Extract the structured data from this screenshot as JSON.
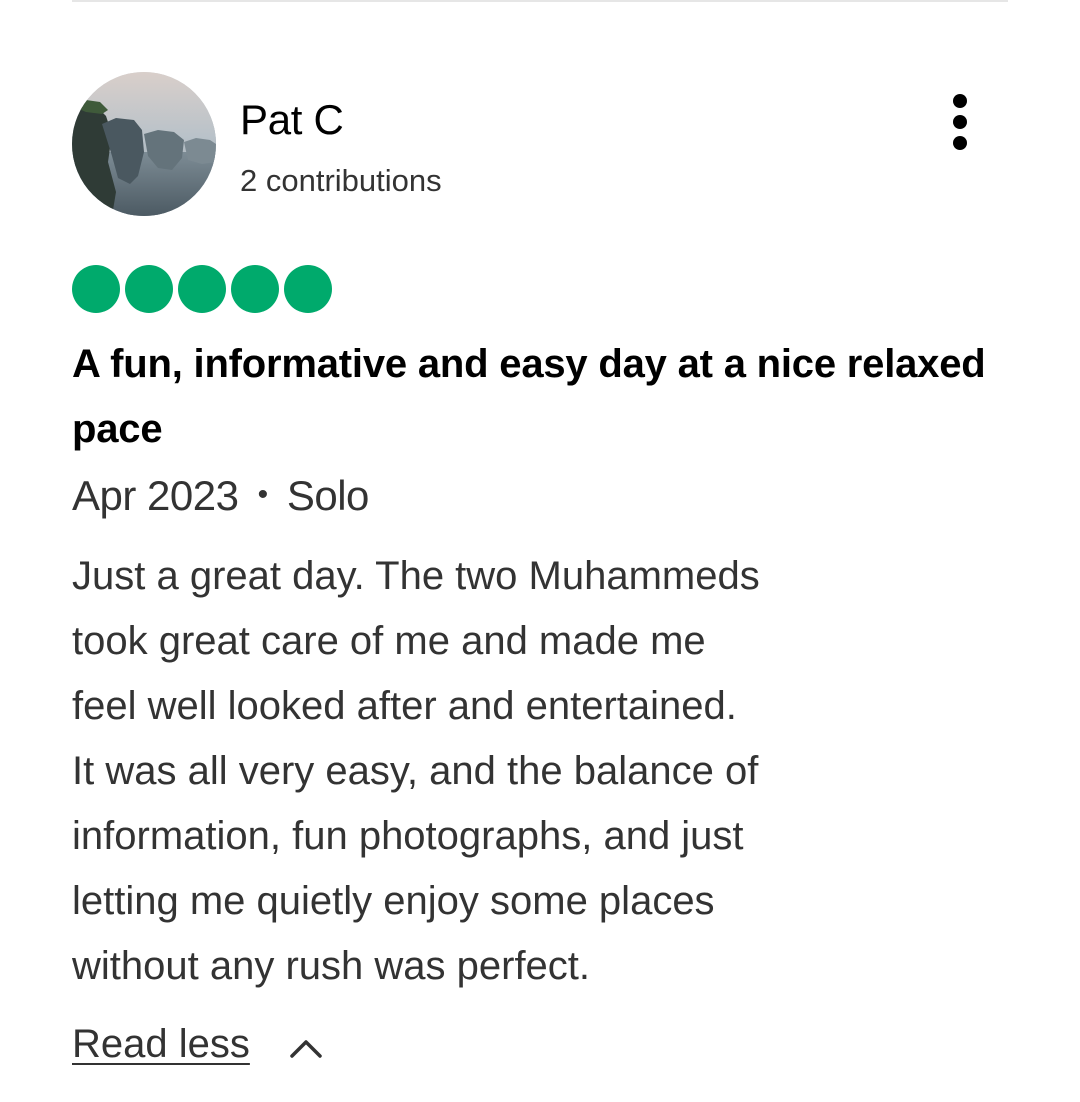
{
  "author": {
    "name": "Pat C",
    "contributions": "2 contributions"
  },
  "review": {
    "rating": 5,
    "rating_max": 5,
    "rating_color": "#00aa6c",
    "title": "A fun, informative and easy day at a nice relaxed pace",
    "date": "Apr 2023",
    "separator": "•",
    "trip_type": "Solo",
    "body_lines": [
      "Just a great day. The two Muhammeds",
      "took great care of me and made me",
      "feel well looked after and entertained.",
      "It was all very easy, and the balance of",
      "information, fun photographs, and just",
      "letting me quietly enjoy some places",
      "without any rush was perfect."
    ],
    "read_less_label": "Read less"
  },
  "icons": {
    "more": "more-vertical-icon",
    "chevron": "chevron-up-icon"
  }
}
